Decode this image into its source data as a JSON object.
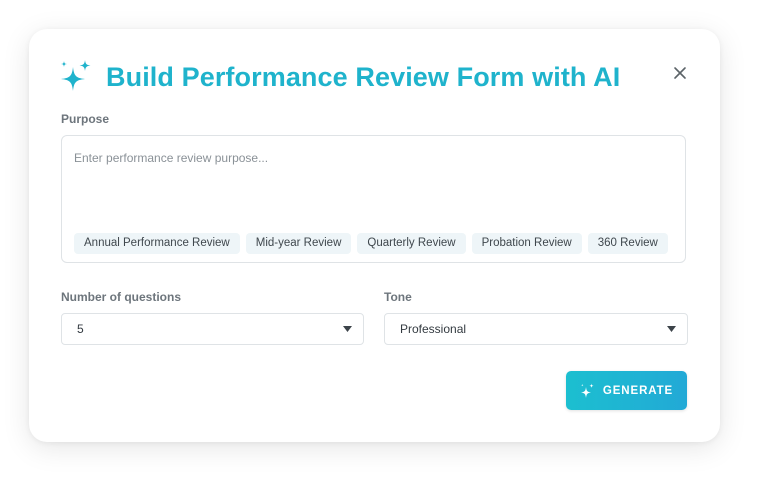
{
  "dialog": {
    "title": "Build Performance Review Form with AI",
    "accent_color": "#1fb3cc",
    "title_icon": "sparkles-icon",
    "close_icon": "close-icon"
  },
  "purpose": {
    "label": "Purpose",
    "placeholder": "Enter performance review purpose...",
    "value": "",
    "suggestions": [
      "Annual Performance Review",
      "Mid-year Review",
      "Quarterly Review",
      "Probation Review",
      "360 Review"
    ]
  },
  "questions": {
    "label": "Number of questions",
    "selected": "5"
  },
  "tone": {
    "label": "Tone",
    "selected": "Professional"
  },
  "generate_button": {
    "label": "GENERATE",
    "icon": "sparkles-icon",
    "colors": [
      "#1cbfd0",
      "#22a9d6"
    ]
  }
}
